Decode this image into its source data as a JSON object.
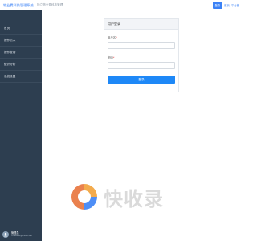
{
  "app": {
    "title": "物业费科技管理系统",
    "subtitle": "独立物业费科技管理"
  },
  "header": {
    "primary_button": "登录",
    "link_home": "首页",
    "link_platform": "平台首"
  },
  "sidebar": {
    "items": [
      {
        "label": "首页"
      },
      {
        "label": "操作员人"
      },
      {
        "label": "操作查询"
      },
      {
        "label": "统计分析"
      },
      {
        "label": "系统设置"
      }
    ],
    "user": {
      "name": "管理员",
      "email": "mnoesb@163.com"
    }
  },
  "login": {
    "card_title": "用户登录",
    "username_label": "用户名",
    "password_label": "密码",
    "required_mark": "*",
    "submit_label": "登录"
  },
  "watermark": {
    "text": "快收录",
    "colors": [
      "#e8743b",
      "#3b82f6",
      "#f2a33a"
    ]
  }
}
